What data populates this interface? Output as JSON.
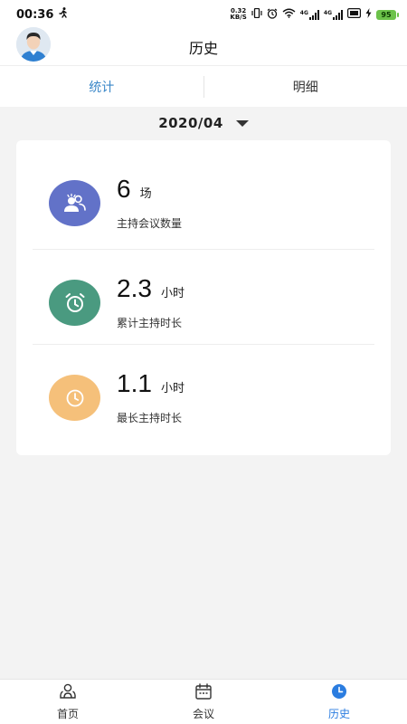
{
  "status_bar": {
    "time": "00:36",
    "net_speed_value": "0.32",
    "net_speed_unit": "KB/S",
    "network_1": "4G",
    "network_2": "4G",
    "battery": "95",
    "icons": [
      "walk-icon",
      "vibrate-icon",
      "alarm-icon",
      "wifi-icon",
      "signal-icon",
      "signal-icon",
      "hd-icon",
      "charging-icon",
      "battery-icon"
    ]
  },
  "header": {
    "title": "历史",
    "avatar_icon": "user-avatar"
  },
  "tabs": [
    {
      "label": "统计",
      "active": true
    },
    {
      "label": "明细",
      "active": false
    }
  ],
  "month_selector": {
    "value": "2020/04",
    "icon": "caret-down-icon"
  },
  "stats": [
    {
      "value": "6",
      "unit": "场",
      "label": "主持会议数量",
      "icon": "group-icon",
      "color": "#6272c8"
    },
    {
      "value": "2.3",
      "unit": "小时",
      "label": "累计主持时长",
      "icon": "alarm-clock-icon",
      "color": "#4a9a80"
    },
    {
      "value": "1.1",
      "unit": "小时",
      "label": "最长主持时长",
      "icon": "clock-icon",
      "color": "#f5c07a"
    }
  ],
  "bottom_nav": [
    {
      "label": "首页",
      "icon": "home-icon",
      "active": false
    },
    {
      "label": "会议",
      "icon": "calendar-icon",
      "active": false
    },
    {
      "label": "历史",
      "icon": "history-clock-icon",
      "active": true
    }
  ],
  "colors": {
    "accent": "#3a87c8",
    "nav_active": "#2b7de0",
    "background": "#f3f3f3"
  }
}
